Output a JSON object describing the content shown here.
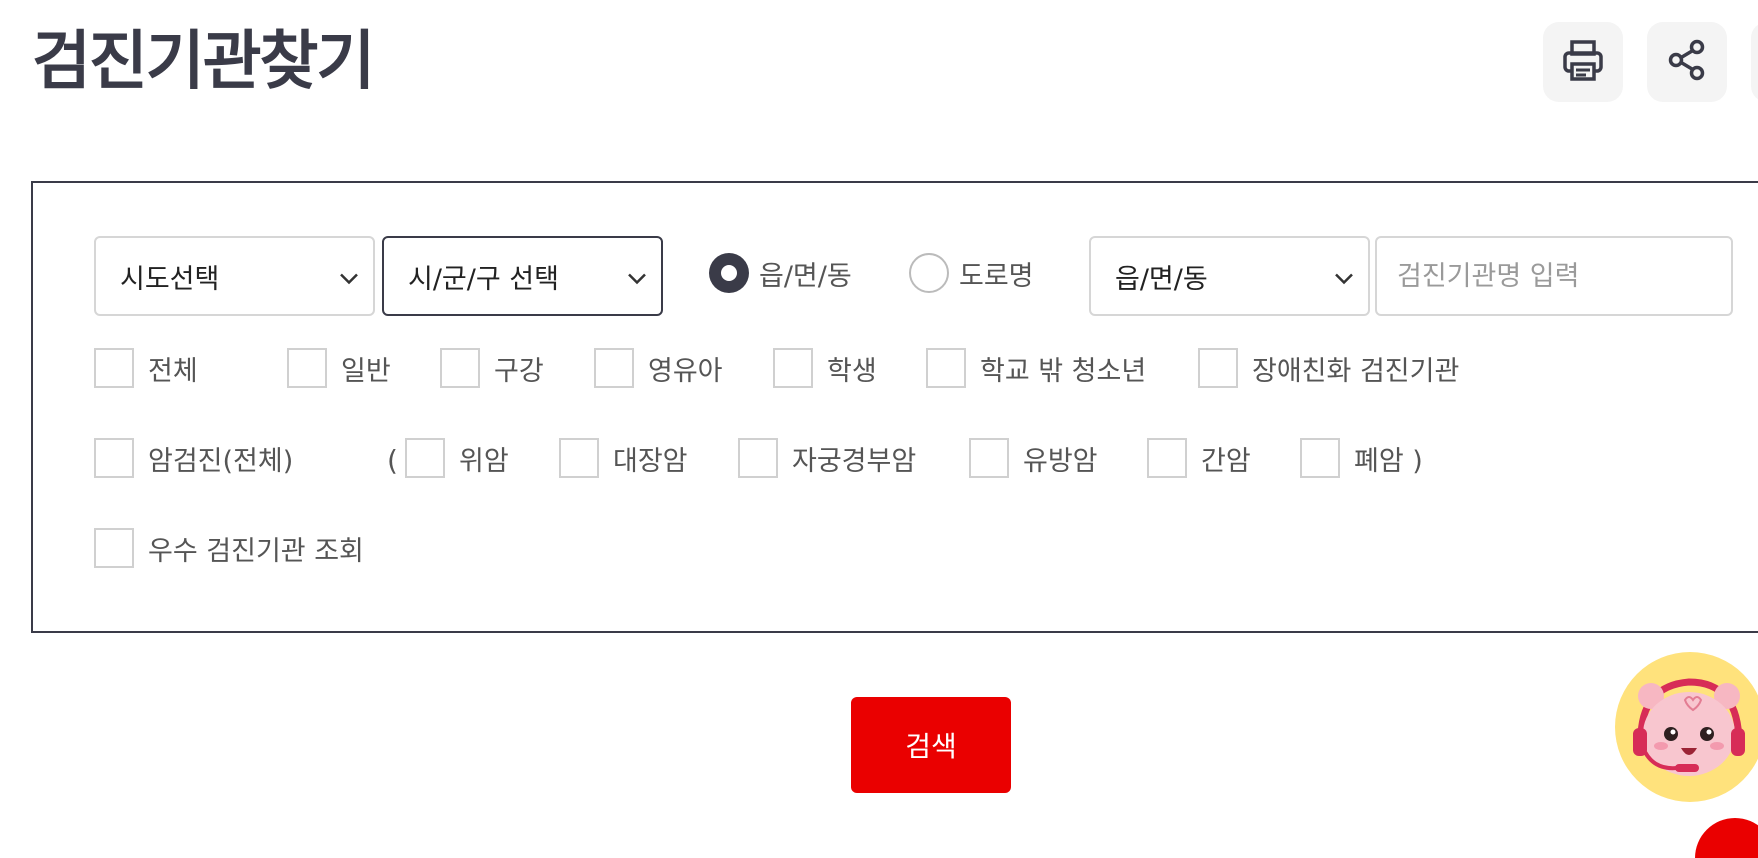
{
  "header": {
    "title": "검진기관찾기"
  },
  "toolbar": {
    "icons": [
      "print-icon",
      "share-icon"
    ]
  },
  "filters": {
    "sido": {
      "value": "시도선택"
    },
    "sigungu": {
      "value": "시/군/구 선택"
    },
    "address_type": {
      "options": [
        {
          "label": "읍/면/동",
          "selected": true
        },
        {
          "label": "도로명",
          "selected": false
        }
      ]
    },
    "emd": {
      "value": "읍/면/동"
    },
    "name_input": {
      "placeholder": "검진기관명 입력",
      "value": ""
    },
    "exam_types": [
      "전체",
      "일반",
      "구강",
      "영유아",
      "학생",
      "학교 밖 청소년",
      "장애친화 검진기관"
    ],
    "cancer": {
      "all_label": "암검진(전체)",
      "open_paren": "(",
      "items": [
        "위암",
        "대장암",
        "자궁경부암",
        "유방암",
        "간암",
        "폐암 )"
      ]
    },
    "excellent_label": "우수 검진기관 조회"
  },
  "actions": {
    "search_label": "검색"
  },
  "colors": {
    "accent_red": "#ea0000",
    "dark": "#3a3b48",
    "mascot_bg": "#ffe27c"
  }
}
